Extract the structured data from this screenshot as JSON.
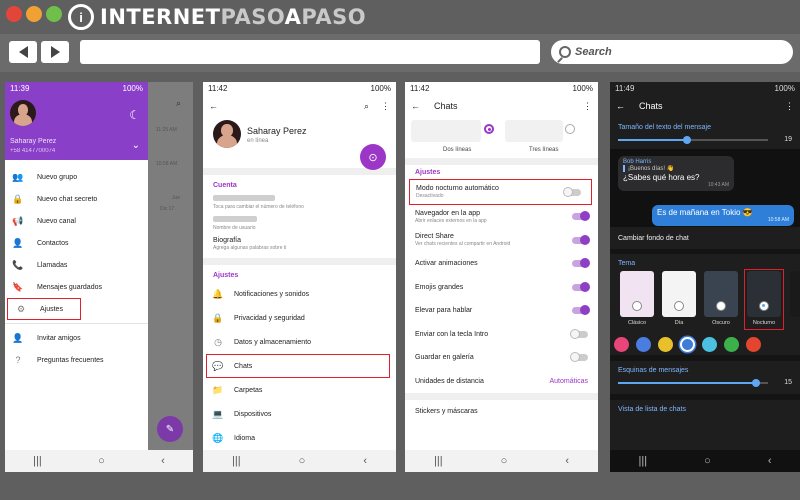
{
  "browser": {
    "logo_text_1": "INTERNET",
    "logo_text_2": "PASO",
    "logo_text_3": "A",
    "logo_text_4": "PASO",
    "search_placeholder": "Search"
  },
  "phone1": {
    "time": "11:39",
    "battery": "100%",
    "user_name": "Saharay Perez",
    "user_phone": "+58 4147700074",
    "menu": [
      {
        "label": "Nuevo grupo",
        "icon": "group-icon"
      },
      {
        "label": "Nuevo chat secreto",
        "icon": "lock-icon"
      },
      {
        "label": "Nuevo canal",
        "icon": "megaphone-icon"
      },
      {
        "label": "Contactos",
        "icon": "person-icon"
      },
      {
        "label": "Llamadas",
        "icon": "phone-icon"
      },
      {
        "label": "Mensajes guardados",
        "icon": "bookmark-icon"
      },
      {
        "label": "Ajustes",
        "icon": "gear-icon"
      }
    ],
    "menu_secondary": [
      {
        "label": "Invitar amigos",
        "icon": "add-person-icon"
      },
      {
        "label": "Preguntas frecuentes",
        "icon": "help-icon"
      }
    ],
    "shade_times": [
      "11:25 AM",
      "10:58 AM",
      "Jue",
      "Dic 17"
    ]
  },
  "phone2": {
    "time": "11:42",
    "battery": "100%",
    "name": "Saharay Perez",
    "status": "en línea",
    "section_cuenta": "Cuenta",
    "phone_hint": "Toca para cambiar el número de teléfono",
    "username_hint": "Nombre de usuario",
    "bio_label": "Biografía",
    "bio_hint": "Agrega algunas palabras sobre ti",
    "section_ajustes": "Ajustes",
    "settings": [
      {
        "label": "Notificaciones y sonidos",
        "icon": "bell-icon"
      },
      {
        "label": "Privacidad y seguridad",
        "icon": "lock-icon"
      },
      {
        "label": "Datos y almacenamiento",
        "icon": "clock-icon"
      },
      {
        "label": "Chats",
        "icon": "chat-icon"
      },
      {
        "label": "Carpetas",
        "icon": "folder-icon"
      },
      {
        "label": "Dispositivos",
        "icon": "laptop-icon"
      },
      {
        "label": "Idioma",
        "icon": "globe-icon"
      }
    ]
  },
  "phone3": {
    "time": "11:42",
    "battery": "100%",
    "title": "Chats",
    "preview_labels": [
      "Dos líneas",
      "Tres líneas"
    ],
    "section_ajustes": "Ajustes",
    "night_mode": {
      "label": "Modo nocturno automático",
      "sub": "Desactivado"
    },
    "toggles": [
      {
        "label": "Navegador en la app",
        "sub": "Abrir enlaces externos en la app",
        "on": true
      },
      {
        "label": "Direct Share",
        "sub": "Ver chats recientes al compartir en Android",
        "on": true
      },
      {
        "label": "Activar animaciones",
        "sub": "",
        "on": true
      },
      {
        "label": "Emojis grandes",
        "sub": "",
        "on": true
      },
      {
        "label": "Elevar para hablar",
        "sub": "",
        "on": true
      },
      {
        "label": "Enviar con la tecla Intro",
        "sub": "",
        "on": false
      },
      {
        "label": "Guardar en galería",
        "sub": "",
        "on": false
      }
    ],
    "distance_label": "Unidades de distancia",
    "distance_value": "Automáticas",
    "stickers": "Stickers y máscaras"
  },
  "phone4": {
    "time": "11:49",
    "battery": "100%",
    "title": "Chats",
    "text_size_label": "Tamaño del texto del mensaje",
    "text_size_value": "19",
    "text_size_fraction": 0.46,
    "reply_sender": "Bob Harris",
    "reply_quote": "¡Buenos días! 👋",
    "msg_in": "¿Sabes qué hora es?",
    "msg_in_time": "10:43 AM",
    "msg_out": "Es de mañana en Tokio 😎",
    "msg_out_time": "10:58 AM",
    "change_bg": "Cambiar fondo de chat",
    "tema_label": "Tema",
    "themes": [
      "Clásico",
      "Día",
      "Oscuro",
      "Nocturno"
    ],
    "corners_label": "Esquinas de mensajes",
    "corners_value": "15",
    "corners_fraction": 0.92,
    "list_view_label": "Vista de lista de chats",
    "accent_colors": [
      "#e8457a",
      "#4a7de0",
      "#e8c02a",
      "#3d7cd9",
      "#4cc0e0",
      "#3cb04a",
      "#e3452f"
    ]
  }
}
